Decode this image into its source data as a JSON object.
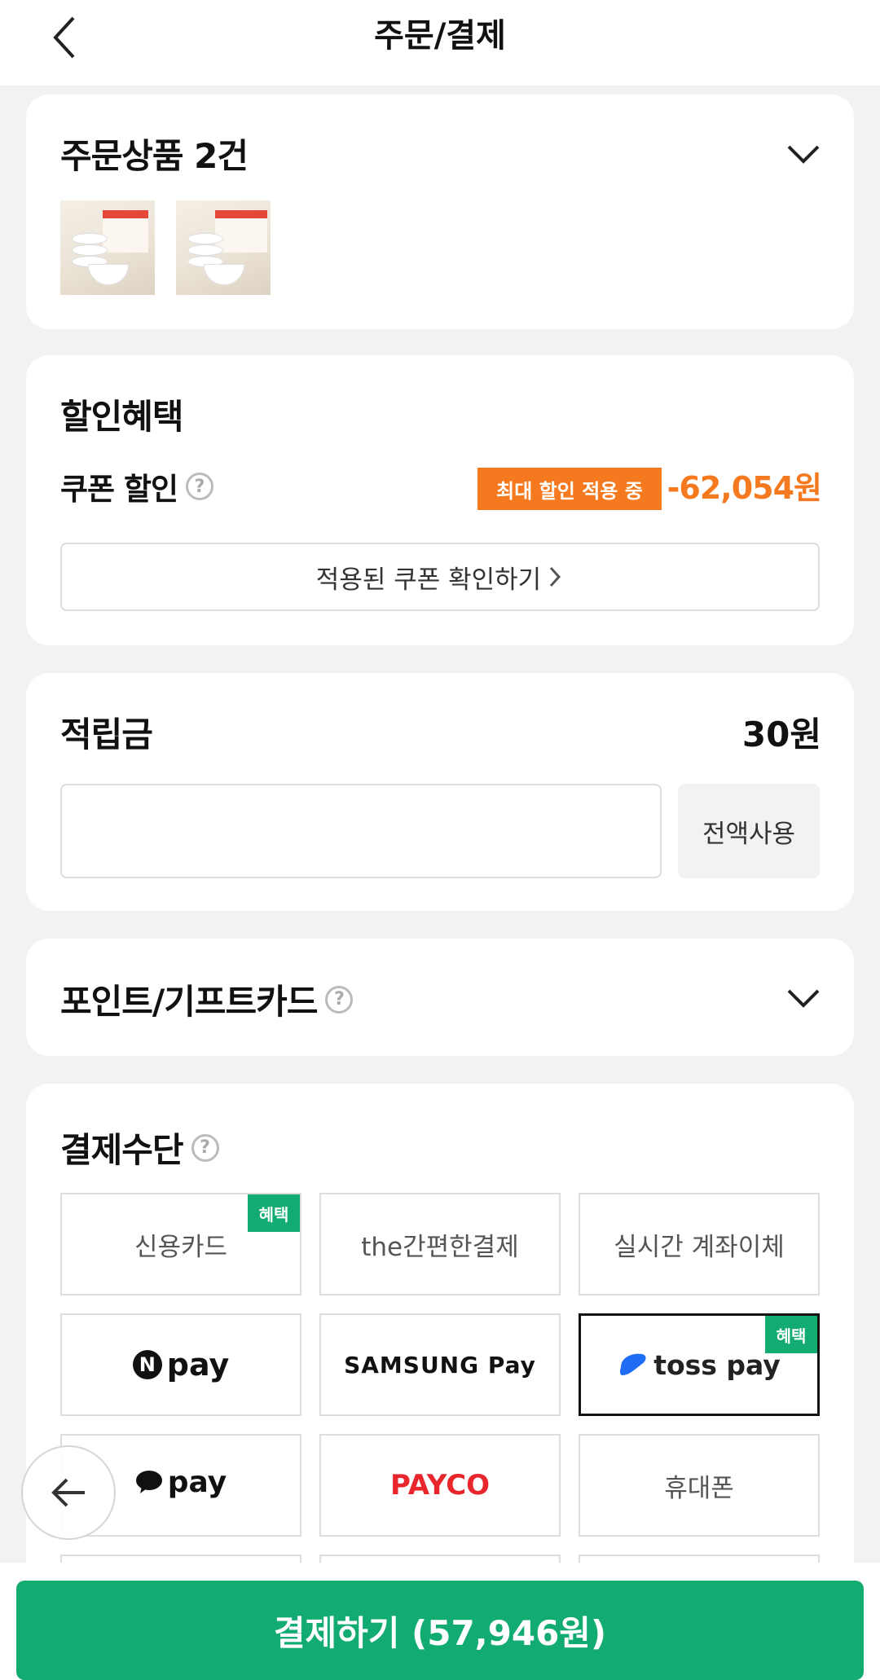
{
  "header": {
    "title": "주문/결제"
  },
  "order_items": {
    "title": "주문상품 2건"
  },
  "discount": {
    "title": "할인혜택",
    "coupon_label": "쿠폰 할인",
    "badge": "최대 할인 적용 중",
    "amount": "-62,054원",
    "check_coupon_button": "적용된 쿠폰 확인하기"
  },
  "points": {
    "title": "적립금",
    "balance": "30원",
    "input_value": "",
    "use_all_button": "전액사용"
  },
  "giftcard": {
    "title": "포인트/기프트카드"
  },
  "payment": {
    "title": "결제수단",
    "benefit_tag": "혜택",
    "methods": {
      "credit_card": "신용카드",
      "the_easy_pay": "the간편한결제",
      "bank_transfer": "실시간 계좌이체",
      "npay": "pay",
      "samsung_pay": "SAMSUNG Pay",
      "toss_pay": "toss pay",
      "kakao_pay": "pay",
      "payco": "PAYCO",
      "mobile": "휴대폰"
    }
  },
  "submit": {
    "label": "결제하기 (57,946원)"
  },
  "colors": {
    "accent_green": "#12ab72",
    "accent_orange": "#f57a1f"
  }
}
